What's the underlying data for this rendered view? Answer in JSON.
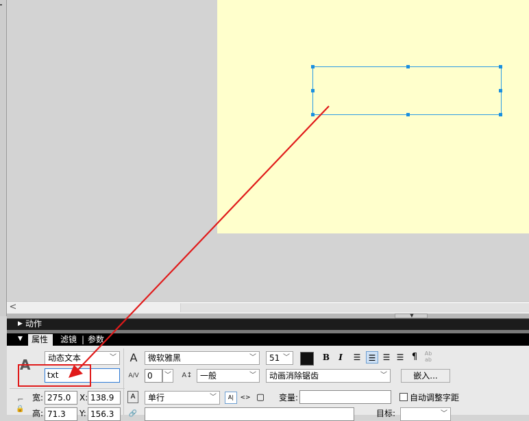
{
  "panels": {
    "actions": {
      "label": "动作"
    },
    "tabs": [
      {
        "label": "属性"
      },
      {
        "label": "滤镜"
      },
      {
        "label": "参数"
      }
    ],
    "tab_separator": "|"
  },
  "properties": {
    "text_type": "动态文本",
    "instance_name": "txt",
    "width_label": "宽:",
    "width_value": "275.0",
    "height_label": "高:",
    "height_value": "71.3",
    "x_label": "X:",
    "x_value": "138.9",
    "y_label": "Y:",
    "y_value": "156.3",
    "font_family": "微软雅黑",
    "font_size": "51",
    "letter_spacing": "0",
    "baseline_shift": "一般",
    "anti_alias": "动画消除锯齿",
    "embed_button": "嵌入...",
    "line_type": "单行",
    "variable_label": "变量:",
    "variable_value": "",
    "auto_kern_label": "自动调整字距",
    "target_label": "目标:",
    "url_value": ""
  },
  "icons": {
    "text_tool": "A",
    "font_icon": "A",
    "letter_spacing_icon": "A/V",
    "baseline_icon": "A↕",
    "bold": "B",
    "italic": "I",
    "paragraph": "¶",
    "selectable_icon": "A|",
    "render_html_icon": "<>",
    "border_icon": "▢",
    "link_icon": "🔗"
  },
  "colors": {
    "stage": "#ffffcc",
    "selection": "#2b9be4",
    "annotation": "#e01a1a"
  }
}
